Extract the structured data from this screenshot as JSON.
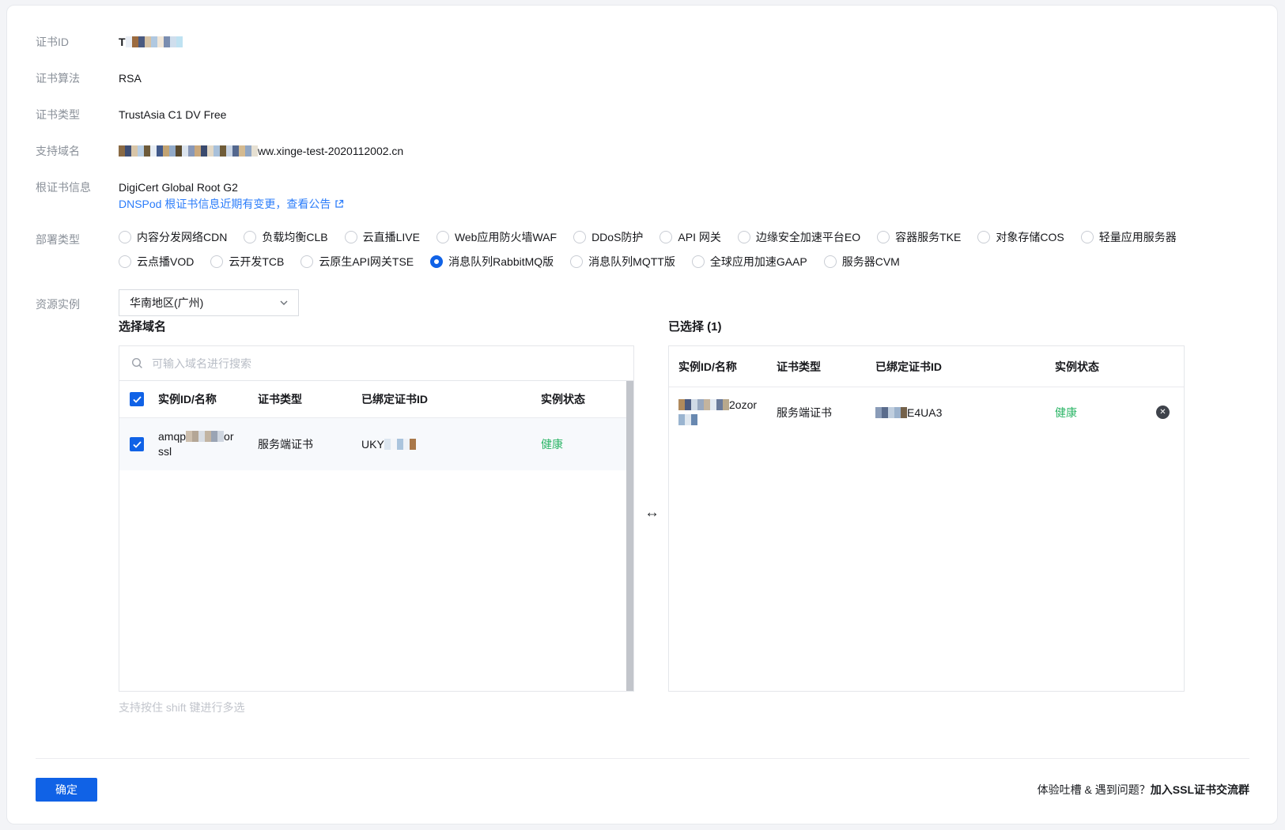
{
  "colors": {
    "accent": "#1062e6",
    "link": "#2c7dfa",
    "success": "#2bb566"
  },
  "form": {
    "cert_id": {
      "label": "证书ID",
      "prefix": "T"
    },
    "algorithm": {
      "label": "证书算法",
      "value": "RSA"
    },
    "cert_type": {
      "label": "证书类型",
      "value": "TrustAsia C1 DV Free"
    },
    "domains": {
      "label": "支持域名",
      "visible_suffix": "ww.xinge-test-2020112002.cn"
    },
    "root_cert": {
      "label": "根证书信息",
      "value": "DigiCert Global Root G2",
      "notice_link": "DNSPod 根证书信息近期有变更，查看公告"
    }
  },
  "deploy": {
    "label": "部署类型",
    "row1": [
      "内容分发网络CDN",
      "负载均衡CLB",
      "云直播LIVE",
      "Web应用防火墙WAF",
      "DDoS防护",
      "API 网关",
      "边缘安全加速平台EO",
      "容器服务TKE",
      "对象存储COS",
      "轻量应用服务器"
    ],
    "row2": [
      "云点播VOD",
      "云开发TCB",
      "云原生API网关TSE",
      "消息队列RabbitMQ版",
      "消息队列MQTT版",
      "全球应用加速GAAP",
      "服务器CVM"
    ],
    "selected": "消息队列RabbitMQ版"
  },
  "resource": {
    "label": "资源实例",
    "selected_region": "华南地区(广州)"
  },
  "left_panel": {
    "title": "选择域名",
    "search_placeholder": "可输入域名进行搜索",
    "columns": [
      "实例ID/名称",
      "证书类型",
      "已绑定证书ID",
      "实例状态"
    ],
    "rows": [
      {
        "name_line1_prefix": "amqp",
        "name_line1_suffix": "or",
        "name_line2": "ssl",
        "cert_type": "服务端证书",
        "bound_id_prefix": "UKY",
        "status": "健康",
        "checked": true
      }
    ],
    "hint": "支持按住 shift 键进行多选"
  },
  "right_panel": {
    "title": "已选择 (1)",
    "columns": [
      "实例ID/名称",
      "证书类型",
      "已绑定证书ID",
      "实例状态"
    ],
    "rows": [
      {
        "name_suffix": "2ozor",
        "cert_type": "服务端证书",
        "bound_id_suffix": "E4UA3",
        "status": "健康"
      }
    ]
  },
  "misc": {
    "transfer_arrow": "↔"
  },
  "footer": {
    "confirm_label": "确定",
    "feedback_prefix": "体验吐槽 & 遇到问题？",
    "feedback_bold": "加入SSL证书交流群"
  },
  "redactions": {
    "cert_id": [
      "#e9eef5",
      "#9c6b3f",
      "#4a5a80",
      "#d6c2a4",
      "#b0c8e0",
      "#f0e6d8",
      "#7a8db0",
      "#cfdeed",
      "#bfe2f2"
    ],
    "domain": [
      "#8a6a44",
      "#3e4e74",
      "#d8c5a8",
      "#b7cde2",
      "#6d5a3a",
      "#e7edf4",
      "#41598a",
      "#c2a372",
      "#92aac8",
      "#5a4a2e",
      "#dce4ee",
      "#8898b8",
      "#caa87c",
      "#3a4a6e",
      "#e2d8c6",
      "#a8c0da",
      "#705c38",
      "#c8d4e4",
      "#54688e",
      "#d4ba90",
      "#90a6c4",
      "#e6e0d2"
    ],
    "left_name": [
      "#cdbfae",
      "#b4a696",
      "#d8dde4",
      "#c2b4a2",
      "#9aa4b4",
      "#cfd6e0"
    ],
    "left_bound": [
      "#dce6f0",
      "#f4f6f9",
      "#aac4dd",
      "#eef2f7",
      "#a9784a"
    ],
    "right_name": [
      "#b08a5c",
      "#4a5a80",
      "#d0dae6",
      "#98a8c0",
      "#c4b49e",
      "#e4eaf2",
      "#6a7a9a",
      "#b8a88c"
    ],
    "right_name2": [
      "#9ab4d0",
      "#e0e8f0",
      "#6888b0"
    ],
    "right_bound": [
      "#8a9cb8",
      "#5a6c8c",
      "#c0cede",
      "#9cb2cc",
      "#74614a"
    ]
  }
}
